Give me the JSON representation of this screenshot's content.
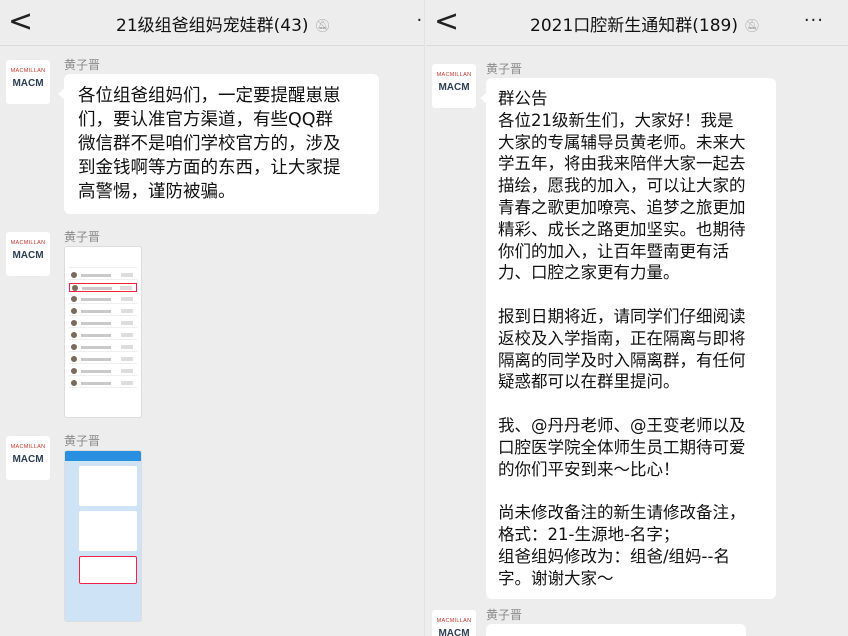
{
  "left": {
    "header": {
      "back": "<",
      "title": "21级组爸组妈宠娃群(43)",
      "mute_icon": "bell-off-icon",
      "more": "··"
    },
    "messages": [
      {
        "sender": "黄子晋",
        "type": "text",
        "text": "各位组爸组妈们，一定要提醒崽崽\n们，要认准官方渠道，有些QQ群\n微信群不是咱们学校官方的，涉及\n到金钱啊等方面的东西，让大家提\n高警惕，谨防被骗。"
      },
      {
        "sender": "黄子晋",
        "type": "image",
        "image_desc": "group-member-list-screenshot"
      },
      {
        "sender": "黄子晋",
        "type": "image",
        "image_desc": "chat-screenshot"
      }
    ]
  },
  "right": {
    "header": {
      "back": "<",
      "title": "2021口腔新生通知群(189)",
      "mute_icon": "bell-off-icon",
      "more": "···"
    },
    "messages": [
      {
        "sender": "黄子晋",
        "type": "text",
        "text": "群公告\n各位21级新生们，大家好！我是\n大家的专属辅导员黄老师。未来大\n学五年，将由我来陪伴大家一起去\n描绘，愿我的加入，可以让大家的\n青春之歌更加嘹亮、追梦之旅更加\n精彩、成长之路更加坚实。也期待\n你们的加入，让百年暨南更有活\n力、口腔之家更有力量。\n\n报到日期将近，请同学们仔细阅读\n返校及入学指南，正在隔离与即将\n隔离的同学及时入隔离群，有任何\n疑惑都可以在群里提问。\n\n我、@丹丹老师、@王变老师以及\n口腔医学院全体师生员工期待可爱\n的你们平安到来～比心！\n\n尚未修改备注的新生请修改备注，\n格式：21-生源地-名字；\n组爸组妈修改为：组爸/组妈--名\n字。谢谢大家～"
      },
      {
        "sender": "黄子晋",
        "type": "text",
        "text": ""
      }
    ]
  },
  "avatar": {
    "brand_top": "MACMILLAN",
    "brand_bottom": "MACM"
  }
}
